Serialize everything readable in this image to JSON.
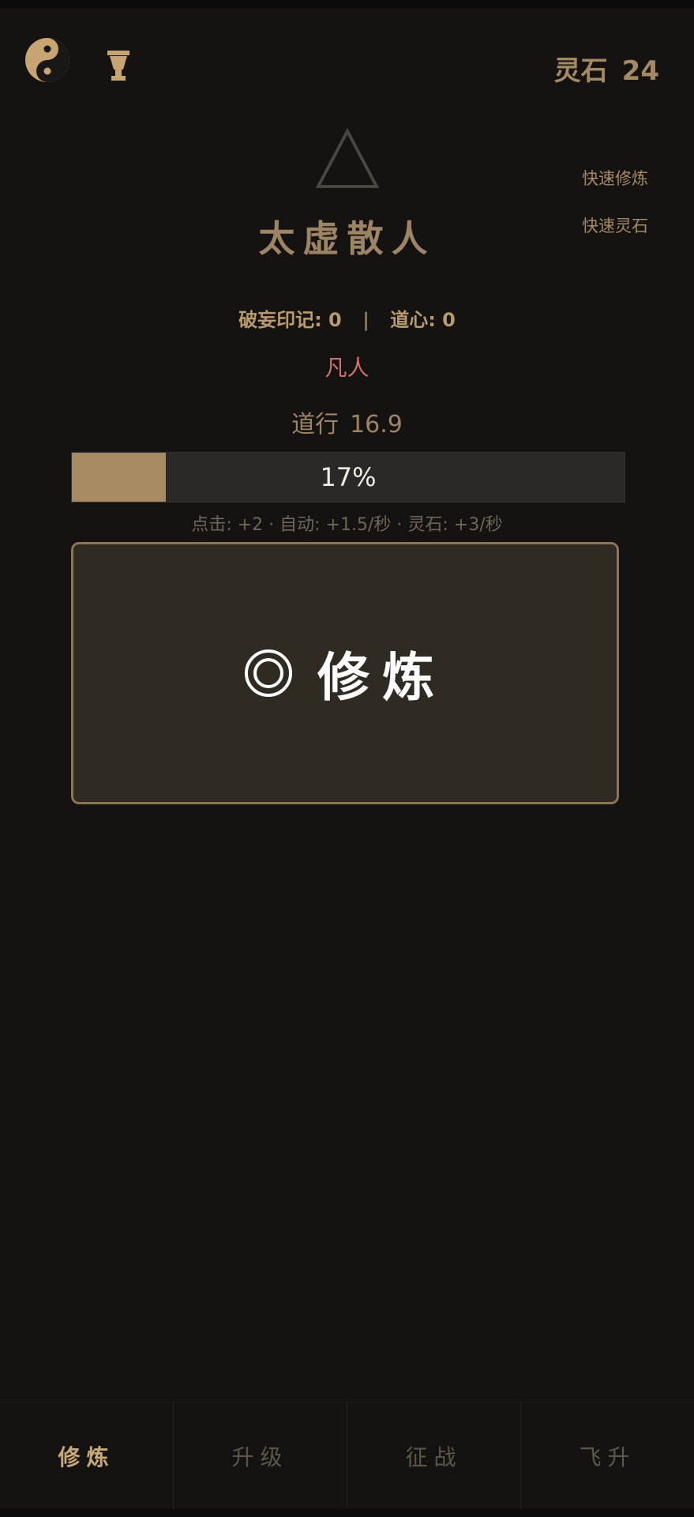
{
  "header": {
    "spirit_stones_label": "灵石",
    "spirit_stones_value": "24"
  },
  "quick_actions": {
    "quick_cultivate": "快速修炼",
    "quick_stones": "快速灵石"
  },
  "profile": {
    "title": "太虚散人",
    "breaking_marks": "破妄印记: 0",
    "separator": "|",
    "dao_heart": "道心: 0",
    "realm": "凡人",
    "daoxing_label": "道行",
    "daoxing_value": "16.9"
  },
  "progress": {
    "percent": 17,
    "label": "17%"
  },
  "rates": "点击: +2 · 自动: +1.5/秒 · 灵石: +3/秒",
  "cultivate_button": {
    "icon": "target-ring-icon",
    "label": "修炼"
  },
  "tabs": [
    {
      "label": "修炼",
      "active": true
    },
    {
      "label": "升级",
      "active": false
    },
    {
      "label": "征战",
      "active": false
    },
    {
      "label": "飞升",
      "active": false
    }
  ],
  "colors": {
    "background": "#141312",
    "accent_gold": "#b89a6c",
    "realm_red": "#d0706a",
    "progress_fill": "#a88b62"
  }
}
